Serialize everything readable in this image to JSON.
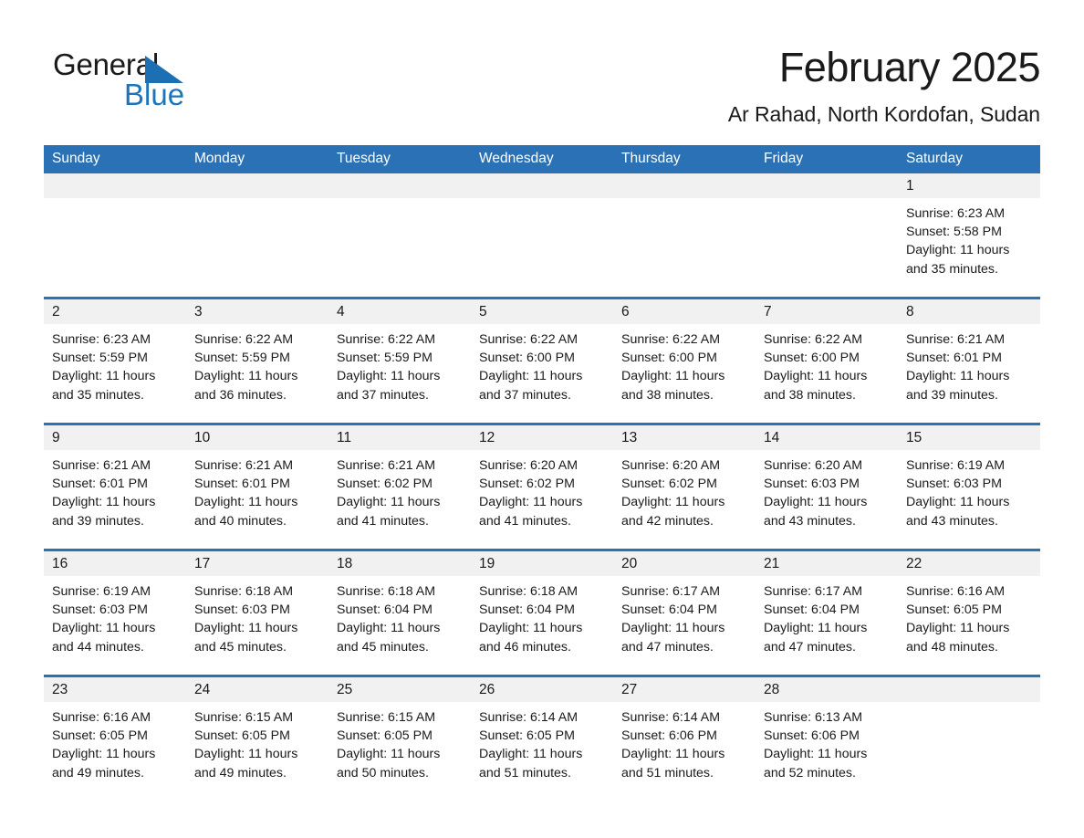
{
  "logo": {
    "word1": "General",
    "word2": "Blue",
    "triangle_color": "#1c6fb3",
    "blue_color": "#1c75bc"
  },
  "header": {
    "title": "February 2025",
    "subtitle": "Ar Rahad, North Kordofan, Sudan"
  },
  "theme": {
    "header_blue": "#2a72b5",
    "daynum_gray": "#f1f1f1",
    "text": "#1a1a1a"
  },
  "weekdays": [
    "Sunday",
    "Monday",
    "Tuesday",
    "Wednesday",
    "Thursday",
    "Friday",
    "Saturday"
  ],
  "weeks": [
    [
      {
        "day": "",
        "details": ""
      },
      {
        "day": "",
        "details": ""
      },
      {
        "day": "",
        "details": ""
      },
      {
        "day": "",
        "details": ""
      },
      {
        "day": "",
        "details": ""
      },
      {
        "day": "",
        "details": ""
      },
      {
        "day": "1",
        "details": "Sunrise: 6:23 AM\nSunset: 5:58 PM\nDaylight: 11 hours\nand 35 minutes."
      }
    ],
    [
      {
        "day": "2",
        "details": "Sunrise: 6:23 AM\nSunset: 5:59 PM\nDaylight: 11 hours\nand 35 minutes."
      },
      {
        "day": "3",
        "details": "Sunrise: 6:22 AM\nSunset: 5:59 PM\nDaylight: 11 hours\nand 36 minutes."
      },
      {
        "day": "4",
        "details": "Sunrise: 6:22 AM\nSunset: 5:59 PM\nDaylight: 11 hours\nand 37 minutes."
      },
      {
        "day": "5",
        "details": "Sunrise: 6:22 AM\nSunset: 6:00 PM\nDaylight: 11 hours\nand 37 minutes."
      },
      {
        "day": "6",
        "details": "Sunrise: 6:22 AM\nSunset: 6:00 PM\nDaylight: 11 hours\nand 38 minutes."
      },
      {
        "day": "7",
        "details": "Sunrise: 6:22 AM\nSunset: 6:00 PM\nDaylight: 11 hours\nand 38 minutes."
      },
      {
        "day": "8",
        "details": "Sunrise: 6:21 AM\nSunset: 6:01 PM\nDaylight: 11 hours\nand 39 minutes."
      }
    ],
    [
      {
        "day": "9",
        "details": "Sunrise: 6:21 AM\nSunset: 6:01 PM\nDaylight: 11 hours\nand 39 minutes."
      },
      {
        "day": "10",
        "details": "Sunrise: 6:21 AM\nSunset: 6:01 PM\nDaylight: 11 hours\nand 40 minutes."
      },
      {
        "day": "11",
        "details": "Sunrise: 6:21 AM\nSunset: 6:02 PM\nDaylight: 11 hours\nand 41 minutes."
      },
      {
        "day": "12",
        "details": "Sunrise: 6:20 AM\nSunset: 6:02 PM\nDaylight: 11 hours\nand 41 minutes."
      },
      {
        "day": "13",
        "details": "Sunrise: 6:20 AM\nSunset: 6:02 PM\nDaylight: 11 hours\nand 42 minutes."
      },
      {
        "day": "14",
        "details": "Sunrise: 6:20 AM\nSunset: 6:03 PM\nDaylight: 11 hours\nand 43 minutes."
      },
      {
        "day": "15",
        "details": "Sunrise: 6:19 AM\nSunset: 6:03 PM\nDaylight: 11 hours\nand 43 minutes."
      }
    ],
    [
      {
        "day": "16",
        "details": "Sunrise: 6:19 AM\nSunset: 6:03 PM\nDaylight: 11 hours\nand 44 minutes."
      },
      {
        "day": "17",
        "details": "Sunrise: 6:18 AM\nSunset: 6:03 PM\nDaylight: 11 hours\nand 45 minutes."
      },
      {
        "day": "18",
        "details": "Sunrise: 6:18 AM\nSunset: 6:04 PM\nDaylight: 11 hours\nand 45 minutes."
      },
      {
        "day": "19",
        "details": "Sunrise: 6:18 AM\nSunset: 6:04 PM\nDaylight: 11 hours\nand 46 minutes."
      },
      {
        "day": "20",
        "details": "Sunrise: 6:17 AM\nSunset: 6:04 PM\nDaylight: 11 hours\nand 47 minutes."
      },
      {
        "day": "21",
        "details": "Sunrise: 6:17 AM\nSunset: 6:04 PM\nDaylight: 11 hours\nand 47 minutes."
      },
      {
        "day": "22",
        "details": "Sunrise: 6:16 AM\nSunset: 6:05 PM\nDaylight: 11 hours\nand 48 minutes."
      }
    ],
    [
      {
        "day": "23",
        "details": "Sunrise: 6:16 AM\nSunset: 6:05 PM\nDaylight: 11 hours\nand 49 minutes."
      },
      {
        "day": "24",
        "details": "Sunrise: 6:15 AM\nSunset: 6:05 PM\nDaylight: 11 hours\nand 49 minutes."
      },
      {
        "day": "25",
        "details": "Sunrise: 6:15 AM\nSunset: 6:05 PM\nDaylight: 11 hours\nand 50 minutes."
      },
      {
        "day": "26",
        "details": "Sunrise: 6:14 AM\nSunset: 6:05 PM\nDaylight: 11 hours\nand 51 minutes."
      },
      {
        "day": "27",
        "details": "Sunrise: 6:14 AM\nSunset: 6:06 PM\nDaylight: 11 hours\nand 51 minutes."
      },
      {
        "day": "28",
        "details": "Sunrise: 6:13 AM\nSunset: 6:06 PM\nDaylight: 11 hours\nand 52 minutes."
      },
      {
        "day": "",
        "details": ""
      }
    ]
  ]
}
